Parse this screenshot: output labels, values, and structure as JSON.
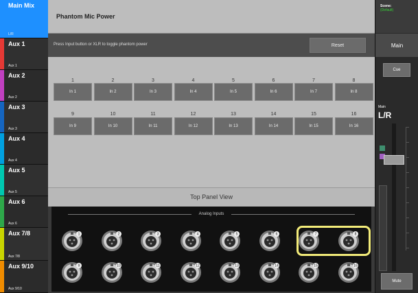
{
  "sidebar": {
    "mixes": [
      {
        "name": "Main Mix",
        "sub": "L/R",
        "color": "#1e90ff",
        "selected": true
      },
      {
        "name": "Aux 1",
        "sub": "Aux 1",
        "color": "#e53935"
      },
      {
        "name": "Aux 2",
        "sub": "Aux 2",
        "color": "#c040c0"
      },
      {
        "name": "Aux 3",
        "sub": "Aux 3",
        "color": "#1565c0"
      },
      {
        "name": "Aux 4",
        "sub": "Aux 4",
        "color": "#00a0e0"
      },
      {
        "name": "Aux 5",
        "sub": "Aux 5",
        "color": "#00c8b0"
      },
      {
        "name": "Aux 6",
        "sub": "Aux 6",
        "color": "#2ea84a"
      },
      {
        "name": "Aux 7/8",
        "sub": "Aux 7/8",
        "color": "#c8d400"
      },
      {
        "name": "Aux 9/10",
        "sub": "Aux 9/10",
        "color": "#f08c00"
      }
    ]
  },
  "header": {
    "title": "Phantom Mic Power"
  },
  "infobar": {
    "hint": "Press Input button or XLR to toggle phantom power",
    "reset_label": "Reset"
  },
  "inputs": {
    "row1_numbers": [
      "1",
      "2",
      "3",
      "4",
      "5",
      "6",
      "7",
      "8"
    ],
    "row1_labels": [
      "In 1",
      "In 2",
      "In 3",
      "In 4",
      "In 5",
      "In 6",
      "In 7",
      "In 8"
    ],
    "row2_numbers": [
      "9",
      "10",
      "11",
      "12",
      "13",
      "14",
      "15",
      "16"
    ],
    "row2_labels": [
      "In 9",
      "In 10",
      "In 11",
      "In 12",
      "In 13",
      "In 14",
      "In 15",
      "In 16"
    ]
  },
  "panel": {
    "title": "Top Panel View",
    "analog_label": "Analog Inputs",
    "xlr_row1": [
      "1",
      "2",
      "3",
      "4",
      "5",
      "6",
      "7",
      "8"
    ],
    "xlr_row2": [
      "9",
      "10",
      "11",
      "12",
      "13",
      "14",
      "15",
      "16"
    ],
    "highlighted": [
      "7",
      "8"
    ]
  },
  "right": {
    "scene_label": "Scene:",
    "scene_value": "(Default)",
    "main_label": "Main",
    "cue_label": "Cue",
    "fader_title": "Main",
    "fader_name": "L/R",
    "mute_label": "Mute"
  }
}
